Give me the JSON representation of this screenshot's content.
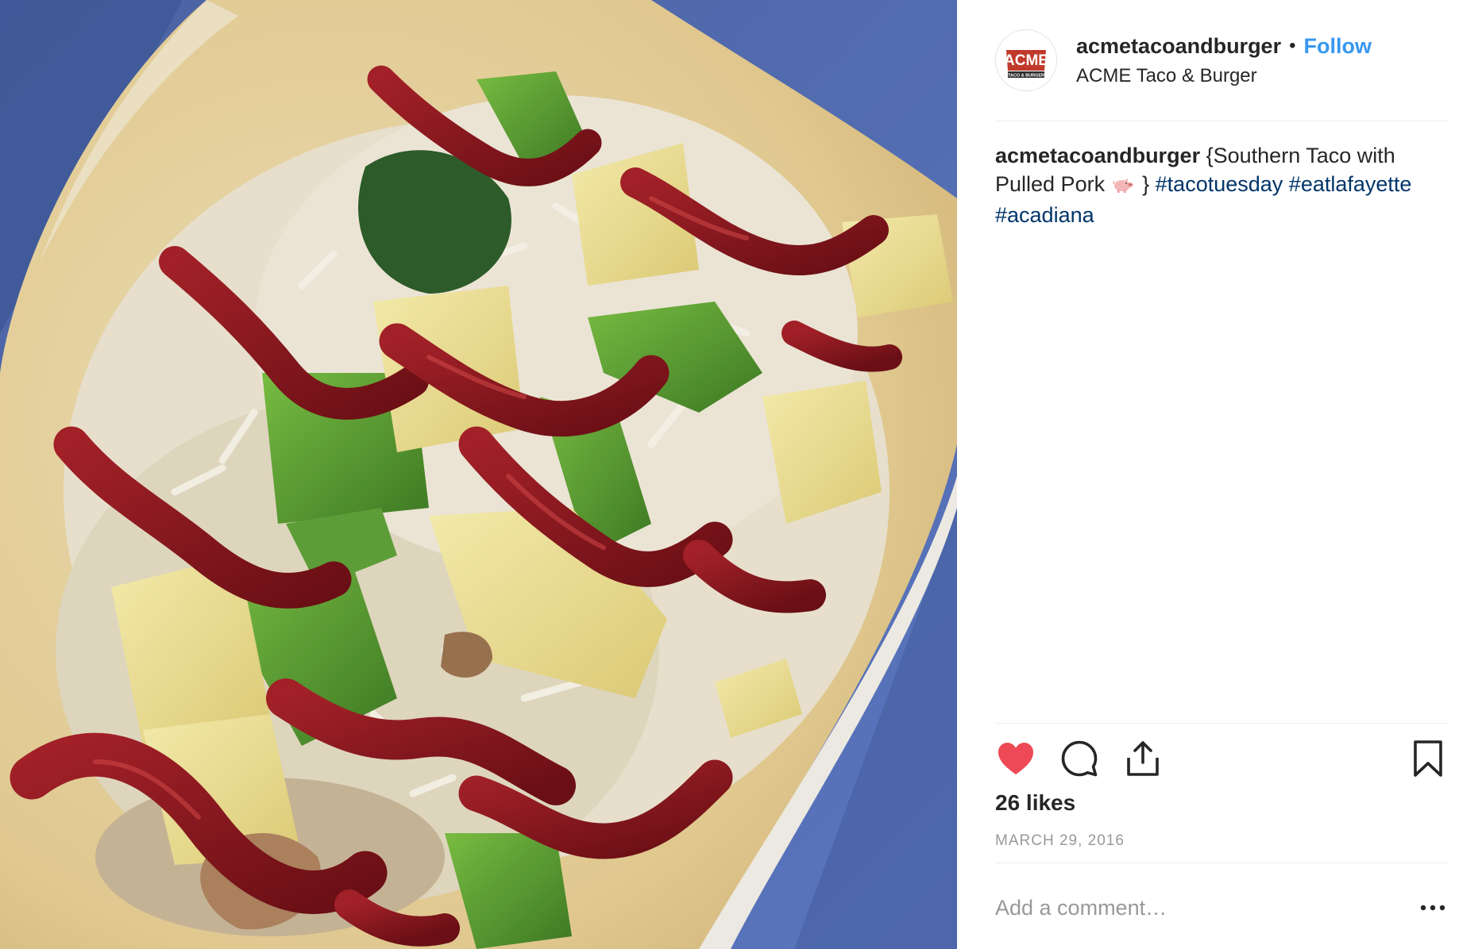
{
  "post": {
    "image_alt": "Taco with pineapple, green peppers, cheese and red sauce",
    "header": {
      "username": "acmetacoandburger",
      "separator": "•",
      "follow_label": "Follow",
      "location": "ACME Taco & Burger",
      "avatar_icon": "acme-logo-icon",
      "avatar_logo_text": "ACME",
      "avatar_logo_subtext": "TACO & BURGER"
    },
    "caption": {
      "username": "acmetacoandburger",
      "text_before_emoji": "{Southern Taco with Pulled Pork",
      "emoji_icon": "pig-icon",
      "text_after_emoji": "}",
      "hashtags": [
        "#tacotuesday",
        "#eatlafayette",
        "#acadiana"
      ]
    },
    "actions": {
      "like_icon": "heart-filled-icon",
      "comment_icon": "comment-icon",
      "share_icon": "share-icon",
      "save_icon": "bookmark-icon"
    },
    "likes": "26 likes",
    "date": "MARCH 29, 2016",
    "comment_placeholder": "Add a comment…",
    "more_icon": "more-horizontal-icon",
    "colors": {
      "like_red": "#ed4956",
      "follow_blue": "#3897f0",
      "hashtag_blue": "#003569",
      "muted_gray": "#999999",
      "text_dark": "#262626"
    }
  }
}
